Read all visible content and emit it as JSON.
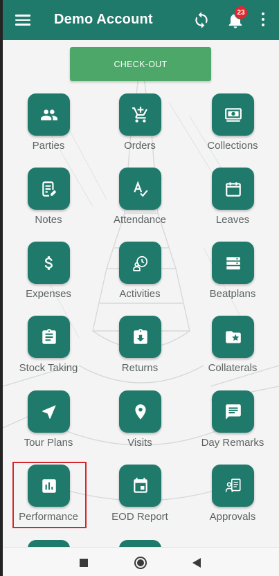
{
  "app_bar": {
    "title": "Demo Account",
    "notification_count": "23",
    "accent_color": "#1f7a6b",
    "badge_color": "#e5262c"
  },
  "checkout_button": {
    "label": "CHECK-OUT",
    "color": "#4da768"
  },
  "tiles": [
    {
      "label": "Parties",
      "icon": "people-icon"
    },
    {
      "label": "Orders",
      "icon": "cart-icon"
    },
    {
      "label": "Collections",
      "icon": "cash-icon"
    },
    {
      "label": "Notes",
      "icon": "note-icon"
    },
    {
      "label": "Attendance",
      "icon": "attendance-icon"
    },
    {
      "label": "Leaves",
      "icon": "calendar-icon"
    },
    {
      "label": "Expenses",
      "icon": "dollar-icon"
    },
    {
      "label": "Activities",
      "icon": "activities-icon"
    },
    {
      "label": "Beatplans",
      "icon": "beatplan-icon"
    },
    {
      "label": "Stock Taking",
      "icon": "clipboard-icon"
    },
    {
      "label": "Returns",
      "icon": "return-icon"
    },
    {
      "label": "Collaterals",
      "icon": "folder-star-icon"
    },
    {
      "label": "Tour Plans",
      "icon": "navigation-icon"
    },
    {
      "label": "Visits",
      "icon": "location-pin-icon"
    },
    {
      "label": "Day Remarks",
      "icon": "comment-icon"
    },
    {
      "label": "Performance",
      "icon": "bar-chart-icon"
    },
    {
      "label": "EOD Report",
      "icon": "event-icon"
    },
    {
      "label": "Approvals",
      "icon": "approval-icon"
    }
  ],
  "highlighted_tile": "Performance",
  "system_nav": {
    "buttons": [
      "recent-apps-icon",
      "home-icon",
      "back-icon"
    ]
  }
}
